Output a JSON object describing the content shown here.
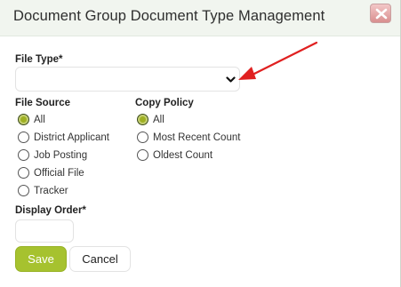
{
  "dialog": {
    "title": "Document Group Document Type Management",
    "close_icon": "close-x-icon"
  },
  "form": {
    "file_type": {
      "label": "File Type*",
      "value": "",
      "icon": "chevron-down-icon"
    },
    "file_source": {
      "label": "File Source",
      "options": [
        {
          "label": "All",
          "checked": true
        },
        {
          "label": "District Applicant",
          "checked": false
        },
        {
          "label": "Job Posting",
          "checked": false
        },
        {
          "label": "Official File",
          "checked": false
        },
        {
          "label": "Tracker",
          "checked": false
        }
      ]
    },
    "copy_policy": {
      "label": "Copy Policy",
      "options": [
        {
          "label": "All",
          "checked": true
        },
        {
          "label": "Most Recent Count",
          "checked": false
        },
        {
          "label": "Oldest Count",
          "checked": false
        }
      ]
    },
    "display_order": {
      "label": "Display Order*",
      "value": ""
    }
  },
  "buttons": {
    "save_label": "Save",
    "cancel_label": "Cancel"
  },
  "annotation": {
    "arrow_color": "#e02020",
    "icon": "red-arrow-icon"
  },
  "colors": {
    "accent": "#a6c22f",
    "titlebar_bg": "#f1f5ef"
  }
}
